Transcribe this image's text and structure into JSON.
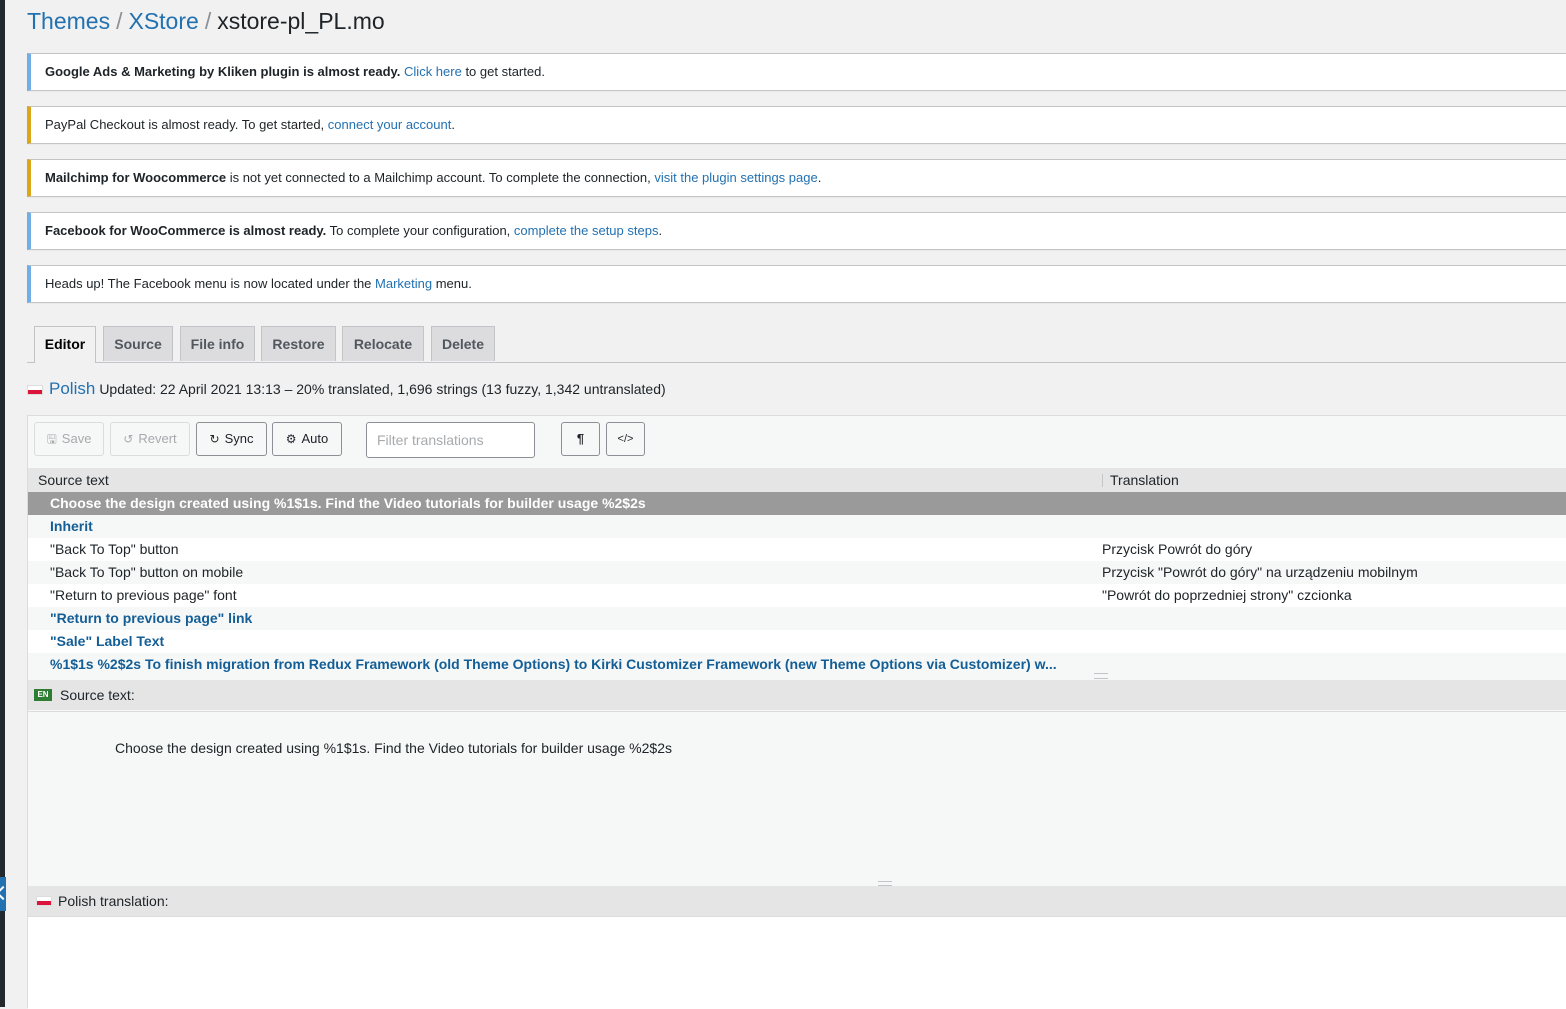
{
  "breadcrumb": {
    "themes": "Themes",
    "theme": "XStore",
    "file": "xstore-pl_PL.mo",
    "separator": "/"
  },
  "notices": {
    "kliken": {
      "bold": "Google Ads & Marketing by Kliken plugin is almost ready.",
      "link": "Click here",
      "after": " to get started."
    },
    "paypal": {
      "text": "PayPal Checkout is almost ready. To get started, ",
      "link": "connect your account",
      "after": "."
    },
    "mailchimp": {
      "bold": "Mailchimp for Woocommerce",
      "text": " is not yet connected to a Mailchimp account. To complete the connection, ",
      "link": "visit the plugin settings page",
      "after": "."
    },
    "facebook": {
      "bold": "Facebook for WooCommerce is almost ready.",
      "text": " To complete your configuration, ",
      "link": "complete the setup steps",
      "after": "."
    },
    "fbmenu": {
      "text": "Heads up! The Facebook menu is now located under the ",
      "link": "Marketing",
      "after": " menu."
    }
  },
  "tabs": [
    "Editor",
    "Source",
    "File info",
    "Restore",
    "Relocate",
    "Delete"
  ],
  "language": {
    "name": "Polish",
    "status": "Updated: 22 April 2021 13:13 – 20% translated, 1,696 strings (13 fuzzy, 1,342 untranslated)"
  },
  "toolbar": {
    "save": "Save",
    "revert": "Revert",
    "sync": "Sync",
    "auto": "Auto",
    "filter_placeholder": "Filter translations",
    "invisibles": "¶",
    "code": "</>"
  },
  "icons": {
    "save": "floppy-icon",
    "revert": "revert-icon",
    "sync": "sync-icon",
    "auto": "robot-icon"
  },
  "list": {
    "col_source": "Source text",
    "col_translation": "Translation",
    "rows": [
      {
        "source": "Choose the design created using %1$1s. Find the Video tutorials for builder usage %2$2s",
        "translation": ""
      },
      {
        "source": "Inherit",
        "translation": ""
      },
      {
        "source": "\"Back To Top\" button",
        "translation": "Przycisk Powrót do góry"
      },
      {
        "source": "\"Back To Top\" button on mobile",
        "translation": "Przycisk \"Powrót do góry\" na urządzeniu mobilnym"
      },
      {
        "source": "\"Return to previous page\" font",
        "translation": "\"Powrót do poprzedniej strony\" czcionka"
      },
      {
        "source": "\"Return to previous page\" link",
        "translation": ""
      },
      {
        "source": "\"Sale\" Label Text",
        "translation": ""
      },
      {
        "source": "%1$1s %2$2s To finish migration from Redux Framework (old Theme Options) to Kirki Customizer Framework (new Theme Options via Customizer) w...",
        "translation": ""
      }
    ]
  },
  "source_pane": {
    "badge": "EN",
    "label": "Source text:",
    "text": "Choose the design created using %1$1s. Find the Video tutorials for builder usage %2$2s"
  },
  "translation_pane": {
    "label": "Polish translation:"
  }
}
